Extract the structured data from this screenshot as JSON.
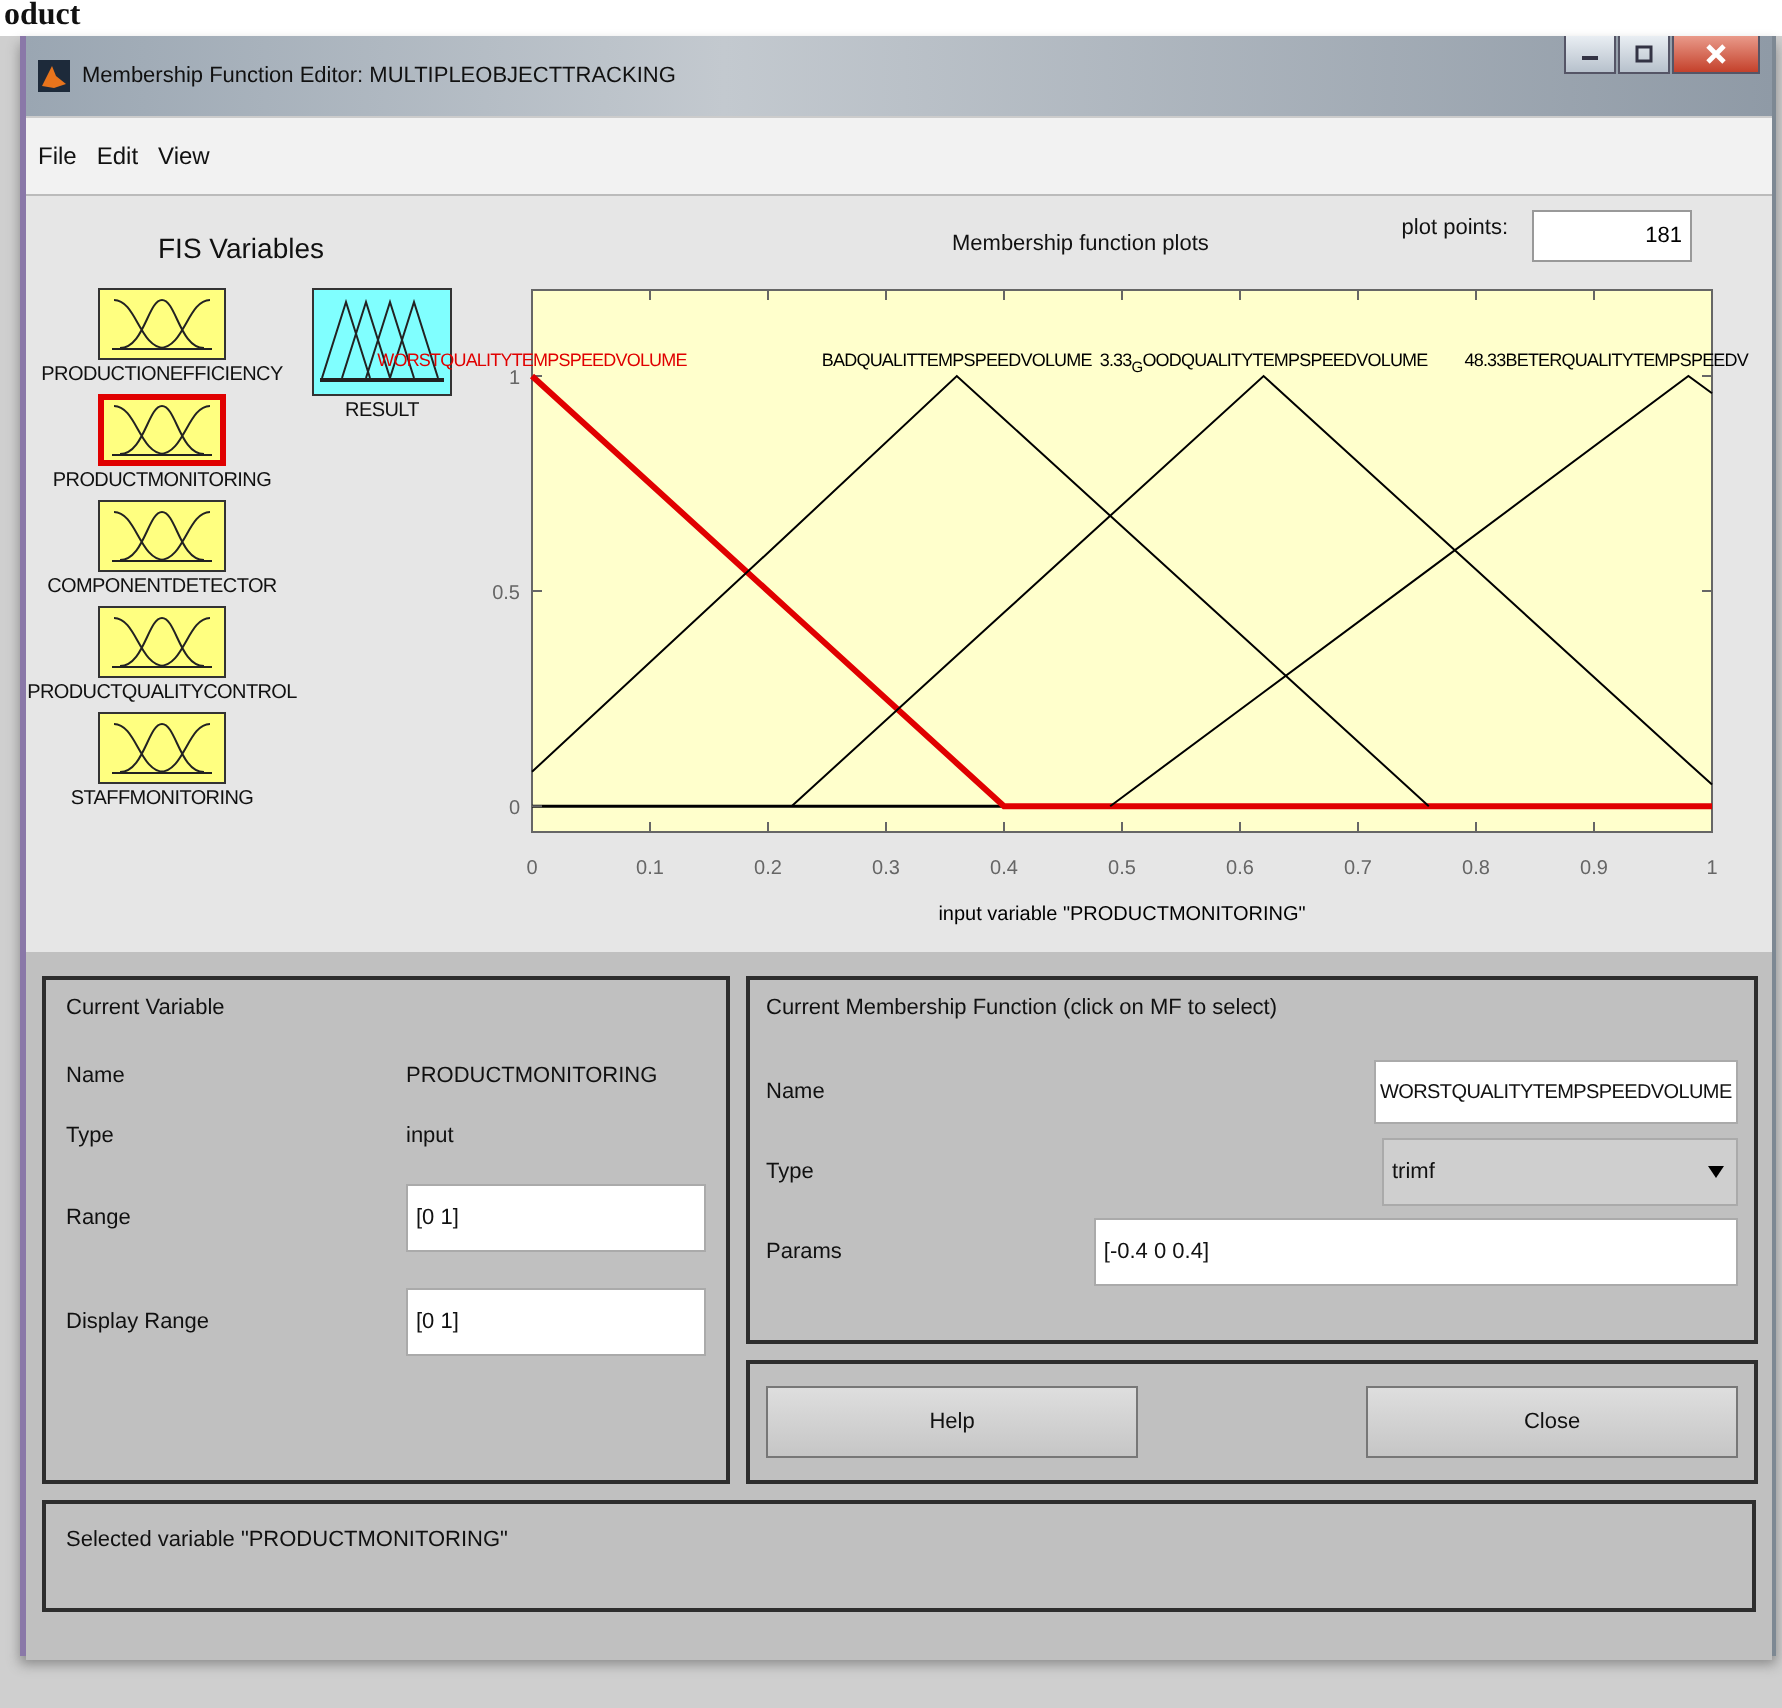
{
  "page_text": "oduct",
  "window": {
    "title": "Membership Function Editor: MULTIPLEOBJECTTRACKING"
  },
  "menu": [
    "File",
    "Edit",
    "View"
  ],
  "fis_variables": {
    "title": "FIS Variables",
    "inputs": [
      {
        "name": "PRODUCTIONEFFICIENCY",
        "selected": false
      },
      {
        "name": "PRODUCTMONITORING",
        "selected": true
      },
      {
        "name": "COMPONENTDETECTOR",
        "selected": false
      },
      {
        "name": "PRODUCTQUALITYCONTROL",
        "selected": false
      },
      {
        "name": "STAFFMONITORING",
        "selected": false
      }
    ],
    "outputs": [
      {
        "name": "RESULT",
        "selected": false
      }
    ]
  },
  "plot": {
    "title": "Membership function plots",
    "plot_points_label": "plot points:",
    "plot_points": "181",
    "chart_data": {
      "type": "line",
      "xlabel": "input variable \"PRODUCTMONITORING\"",
      "x": [
        0,
        0.22,
        0.36,
        0.4,
        0.49,
        0.62,
        0.76,
        0.98,
        1
      ],
      "series": [
        {
          "name": "WORSTQUALITYTEMPSPEEDVOLUME",
          "color": "#e00000",
          "values": [
            1,
            0.45,
            0.1,
            0,
            0,
            0,
            0,
            0,
            0
          ]
        },
        {
          "name": "BADQUALITTEMPSPEEDVOLUME",
          "color": "#000000",
          "values": [
            0.08,
            0.64,
            1,
            0.9,
            0.675,
            0.35,
            0,
            null,
            null
          ]
        },
        {
          "name": "3.33$_{G}$OODQUALITYTEMPSPEEDVOLUME",
          "color": "#000000",
          "values": [
            null,
            0,
            0.35,
            0.45,
            0.675,
            1,
            0.65,
            0.1,
            0.05
          ]
        },
        {
          "name": "48.33BETERQUALITYTEMPSPEEDV",
          "color": "#000000",
          "values": [
            null,
            null,
            null,
            null,
            0,
            0.265,
            0.55,
            1,
            0.96
          ]
        }
      ],
      "xlim": [
        0,
        1
      ],
      "ylim": [
        -0.06,
        1.2
      ],
      "xticks": [
        0,
        0.1,
        0.2,
        0.3,
        0.4,
        0.5,
        0.6,
        0.7,
        0.8,
        0.9,
        1
      ],
      "yticks": [
        0,
        0.5,
        1
      ]
    }
  },
  "current_variable": {
    "title": "Current Variable",
    "name_label": "Name",
    "name": "PRODUCTMONITORING",
    "type_label": "Type",
    "type": "input",
    "range_label": "Range",
    "range": "[0 1]",
    "display_range_label": "Display Range",
    "display_range": "[0 1]"
  },
  "current_mf": {
    "title": "Current Membership Function (click on MF to select)",
    "name_label": "Name",
    "name": "WORSTQUALITYTEMPSPEEDVOLUME",
    "type_label": "Type",
    "type": "trimf",
    "params_label": "Params",
    "params": "[-0.4 0 0.4]"
  },
  "buttons": [
    "Help",
    "Close"
  ],
  "status": "Selected variable \"PRODUCTMONITORING\""
}
